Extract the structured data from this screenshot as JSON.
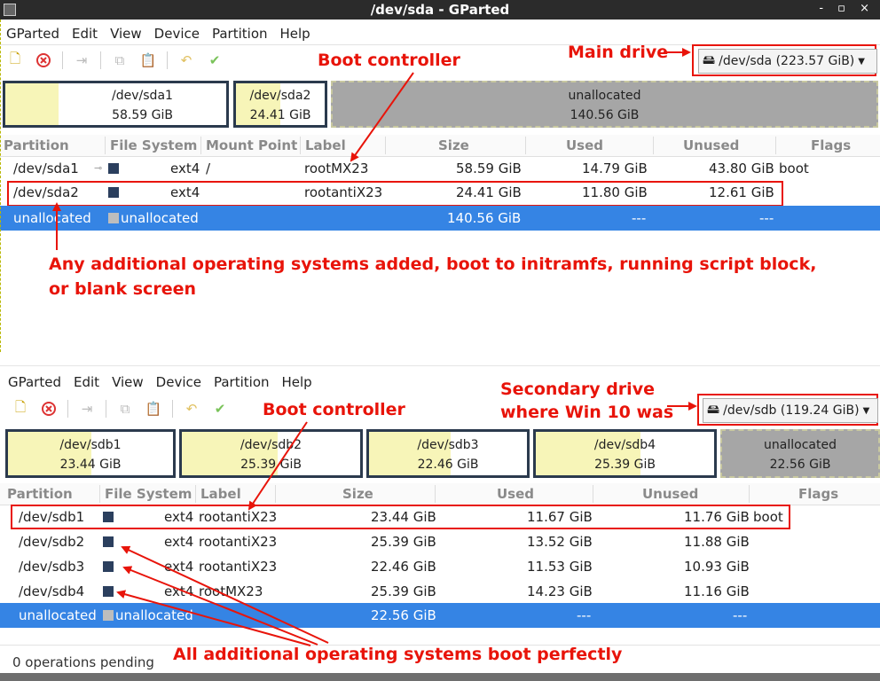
{
  "window": {
    "title": "/dev/sda - GParted",
    "controls": "- ▫ ×"
  },
  "top": {
    "menu": [
      "GParted",
      "Edit",
      "View",
      "Device",
      "Partition",
      "Help"
    ],
    "device_selector": "/dev/sda (223.57 GiB)",
    "partitions_map": [
      {
        "name": "/dev/sda1",
        "size": "58.59 GiB"
      },
      {
        "name": "/dev/sda2",
        "size": "24.41 GiB"
      },
      {
        "name": "unallocated",
        "size": "140.56 GiB"
      }
    ],
    "columns": [
      "Partition",
      "File System",
      "Mount Point",
      "Label",
      "Size",
      "Used",
      "Unused",
      "Flags"
    ],
    "rows": [
      {
        "partition": "/dev/sda1",
        "fs": "ext4",
        "mount": "/",
        "label": "rootMX23",
        "size": "58.59 GiB",
        "used": "14.79 GiB",
        "unused": "43.80 GiB",
        "flags": "boot"
      },
      {
        "partition": "/dev/sda2",
        "fs": "ext4",
        "mount": "",
        "label": "rootantiX23",
        "size": "24.41 GiB",
        "used": "11.80 GiB",
        "unused": "12.61 GiB",
        "flags": ""
      },
      {
        "partition": "unallocated",
        "fs": "unallocated",
        "mount": "",
        "label": "",
        "size": "140.56 GiB",
        "used": "---",
        "unused": "---",
        "flags": ""
      }
    ],
    "annotations": {
      "main_drive": "Main drive",
      "boot_controller": "Boot controller",
      "note_line1": "Any additional operating systems added, boot to initramfs, running script block,",
      "note_line2": "or blank screen"
    }
  },
  "bottom": {
    "menu": [
      "GParted",
      "Edit",
      "View",
      "Device",
      "Partition",
      "Help"
    ],
    "device_selector": "/dev/sdb (119.24 GiB)",
    "partitions_map": [
      {
        "name": "/dev/sdb1",
        "size": "23.44 GiB"
      },
      {
        "name": "/dev/sdb2",
        "size": "25.39 GiB"
      },
      {
        "name": "/dev/sdb3",
        "size": "22.46 GiB"
      },
      {
        "name": "/dev/sdb4",
        "size": "25.39 GiB"
      },
      {
        "name": "unallocated",
        "size": "22.56 GiB"
      }
    ],
    "columns": [
      "Partition",
      "File System",
      "Label",
      "Size",
      "Used",
      "Unused",
      "Flags"
    ],
    "rows": [
      {
        "partition": "/dev/sdb1",
        "fs": "ext4",
        "label": "rootantiX23",
        "size": "23.44 GiB",
        "used": "11.67 GiB",
        "unused": "11.76 GiB",
        "flags": "boot"
      },
      {
        "partition": "/dev/sdb2",
        "fs": "ext4",
        "label": "rootantiX23",
        "size": "25.39 GiB",
        "used": "13.52 GiB",
        "unused": "11.88 GiB",
        "flags": ""
      },
      {
        "partition": "/dev/sdb3",
        "fs": "ext4",
        "label": "rootantiX23",
        "size": "22.46 GiB",
        "used": "11.53 GiB",
        "unused": "10.93 GiB",
        "flags": ""
      },
      {
        "partition": "/dev/sdb4",
        "fs": "ext4",
        "label": "rootMX23",
        "size": "25.39 GiB",
        "used": "14.23 GiB",
        "unused": "11.16 GiB",
        "flags": ""
      },
      {
        "partition": "unallocated",
        "fs": "unallocated",
        "label": "",
        "size": "22.56 GiB",
        "used": "---",
        "unused": "---",
        "flags": ""
      }
    ],
    "annotations": {
      "secondary_line1": "Secondary drive",
      "secondary_line2": "where Win 10 was",
      "boot_controller": "Boot controller",
      "all_boot": "All additional operating systems boot perfectly"
    },
    "status": "0 operations pending"
  },
  "colors": {
    "annotation_red": "#e8140a",
    "selection_blue": "#3584e4",
    "partition_border": "#2b3a4d",
    "used_fill": "#f7f5b8",
    "unallocated": "#a6a6a6"
  }
}
